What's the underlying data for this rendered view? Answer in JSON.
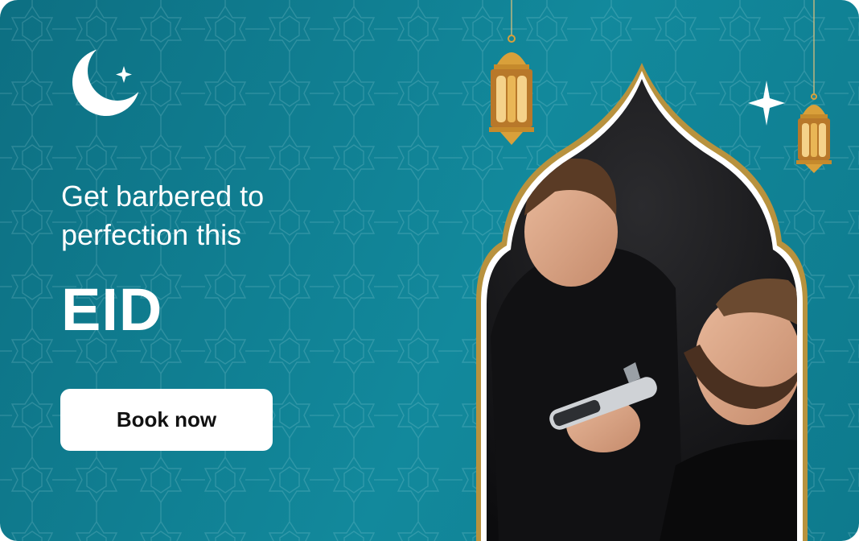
{
  "banner": {
    "headline_line1": "Get barbered to",
    "headline_line2": "perfection this",
    "occasion": "EID",
    "cta_label": "Book now"
  },
  "icons": [
    "crescent-moon-icon",
    "star-sparkle-icon",
    "lantern-icon",
    "lantern-icon",
    "star-sparkle-icon"
  ],
  "colors": {
    "background": "#12899c",
    "arch_border": "#ffffff",
    "arch_gold": "#b8923e",
    "lantern_gold": "#d9a03a",
    "cta_background": "#ffffff",
    "cta_text": "#111111"
  },
  "image": {
    "subject": "barber-photo"
  }
}
